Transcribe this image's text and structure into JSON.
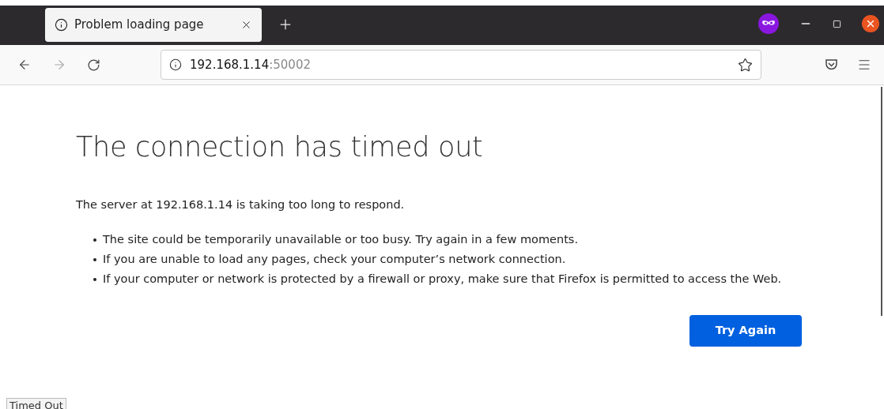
{
  "tab": {
    "title": "Problem loading page",
    "selected": true
  },
  "address": {
    "host": "192.168.1.14",
    "port": ":50002"
  },
  "page": {
    "heading": "The connection has timed out",
    "message": "The server at 192.168.1.14 is taking too long to respond.",
    "bullets": [
      "The site could be temporarily unavailable or too busy. Try again in a few moments.",
      "If you are unable to load any pages, check your computer’s network connection.",
      "If your computer or network is protected by a firewall or proxy, make sure that Firefox is permitted to access the Web."
    ],
    "button": "Try Again"
  },
  "status": "Timed Out"
}
